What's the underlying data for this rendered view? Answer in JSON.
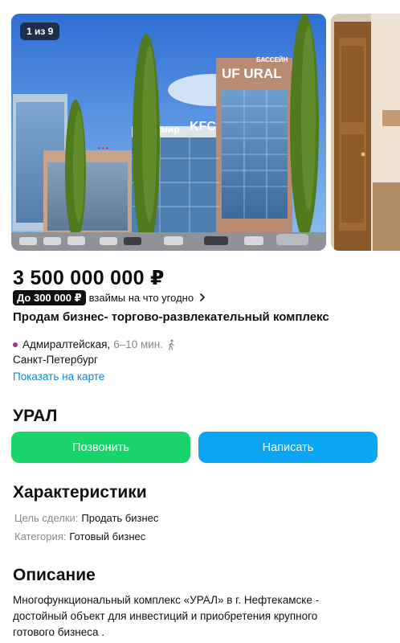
{
  "gallery": {
    "counter": "1 из 9",
    "signs": {
      "ural": "URAL",
      "ural_top": "БАССЕЙН",
      "kfc": "KFC",
      "mir": "мир"
    }
  },
  "listing": {
    "price": "3 500 000 000 ₽",
    "loan_badge": "До 300 000 ₽",
    "loan_text": "взаймы на что угодно",
    "title": "Продам бизнес- торгово-развлекательный комплекс",
    "metro_station": "Адмиралтейская,",
    "metro_time": "6–10 мин.",
    "city": "Санкт-Петербург",
    "map_link": "Показать на карте"
  },
  "seller": {
    "name": "УРАЛ",
    "call_label": "Позвонить",
    "write_label": "Написать"
  },
  "characteristics": {
    "heading": "Характеристики",
    "rows": [
      {
        "key": "Цель сделки:",
        "value": "Продать бизнес"
      },
      {
        "key": "Категория:",
        "value": "Готовый бизнес"
      }
    ]
  },
  "description": {
    "heading": "Описание",
    "text": "Многофункциональный комплекс «УРАЛ» в г. Нефтекамске - достойный объект для инвестиций и приобретения крупного готового бизнеса ."
  },
  "colors": {
    "call_button": "#19d46b",
    "write_button": "#0aa6f4",
    "link": "#0a88d8",
    "metro_line": "#a0338b"
  },
  "icons": [
    "chevron-right-icon",
    "walking-person-icon",
    "metro-dot-icon"
  ]
}
